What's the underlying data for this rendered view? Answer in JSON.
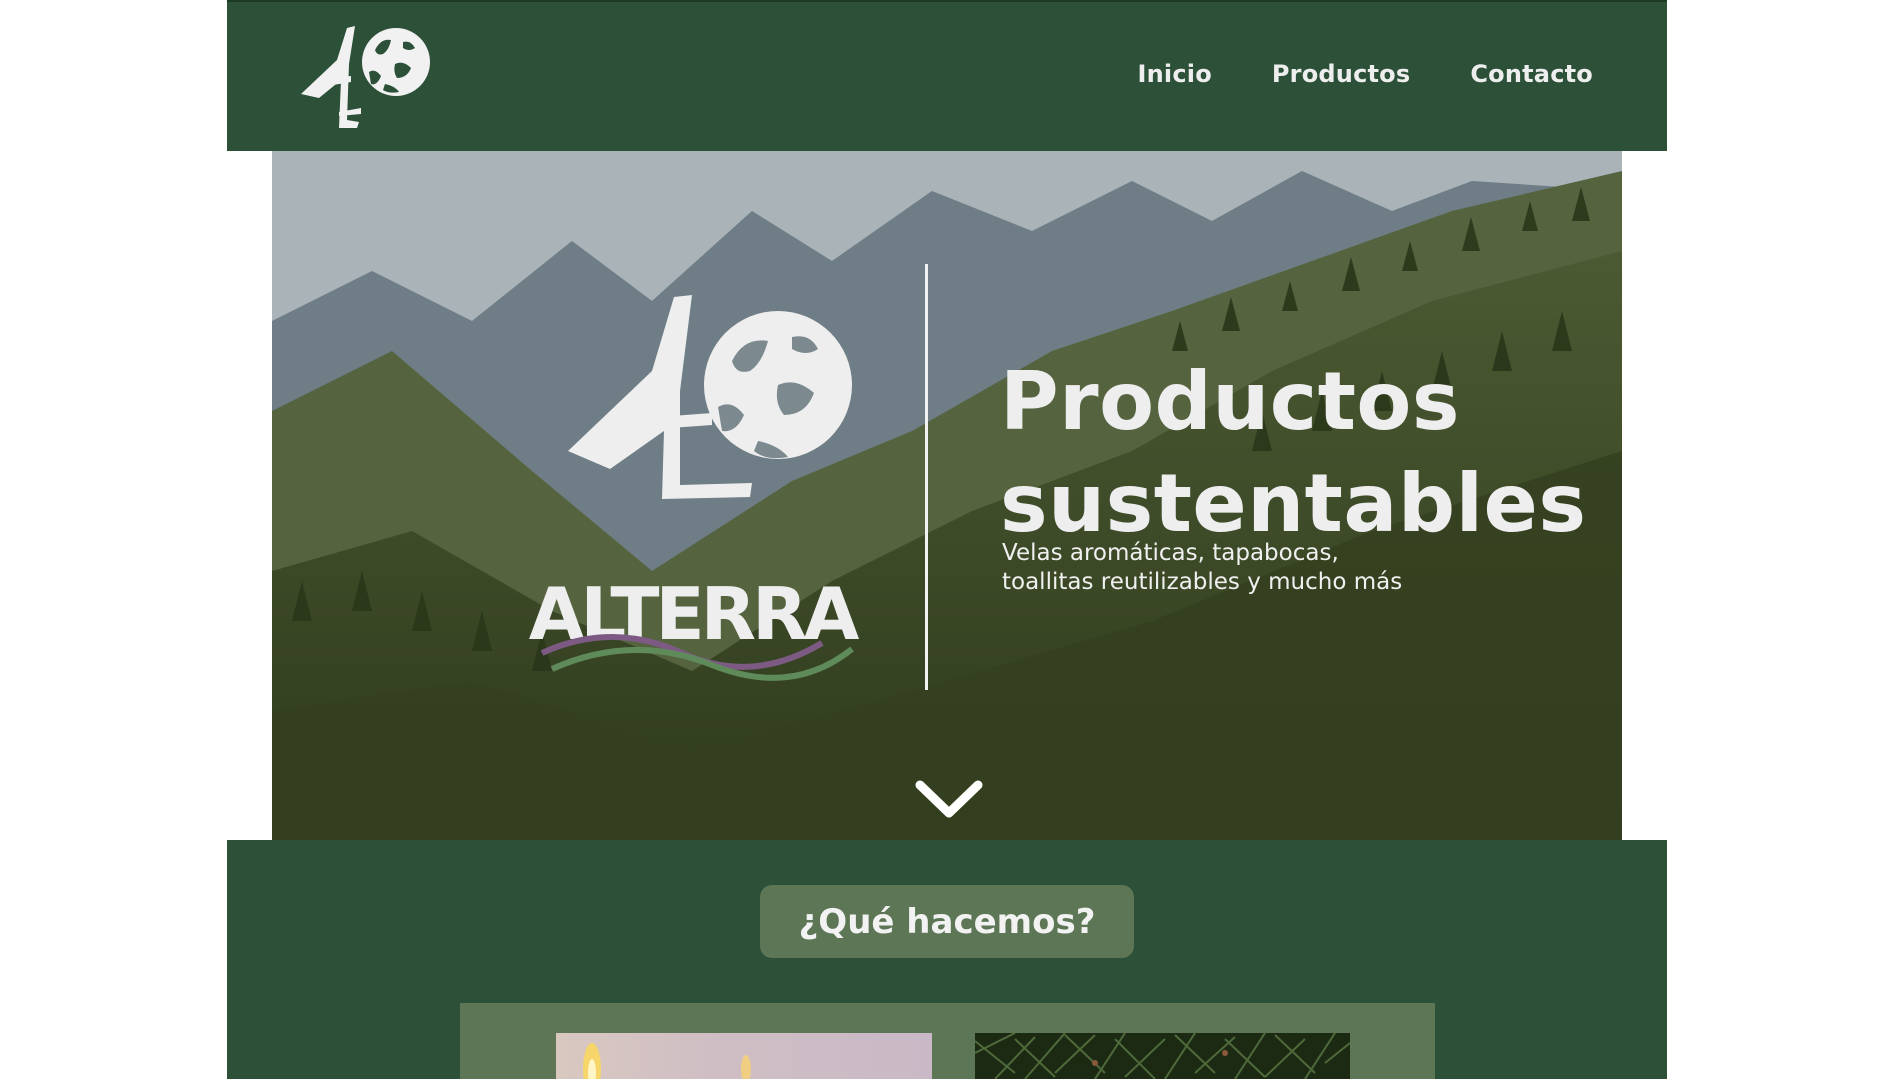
{
  "nav": {
    "items": [
      {
        "label": "Inicio"
      },
      {
        "label": "Productos"
      },
      {
        "label": "Contacto"
      }
    ]
  },
  "hero": {
    "title_line1": "Productos",
    "title_line2": "sustentables",
    "subtitle_line1": "Velas aromáticas, tapabocas,",
    "subtitle_line2": "toallitas reutilizables y mucho más",
    "brand_wordmark": "ALTERRA"
  },
  "section": {
    "heading": "¿Qué hacemos?"
  },
  "colors": {
    "header_bg": "#2c5038",
    "accent_pill": "#5c7656",
    "text_light": "#eeeeee"
  },
  "icons": [
    "alterra-logo-icon",
    "chevron-down-icon"
  ]
}
